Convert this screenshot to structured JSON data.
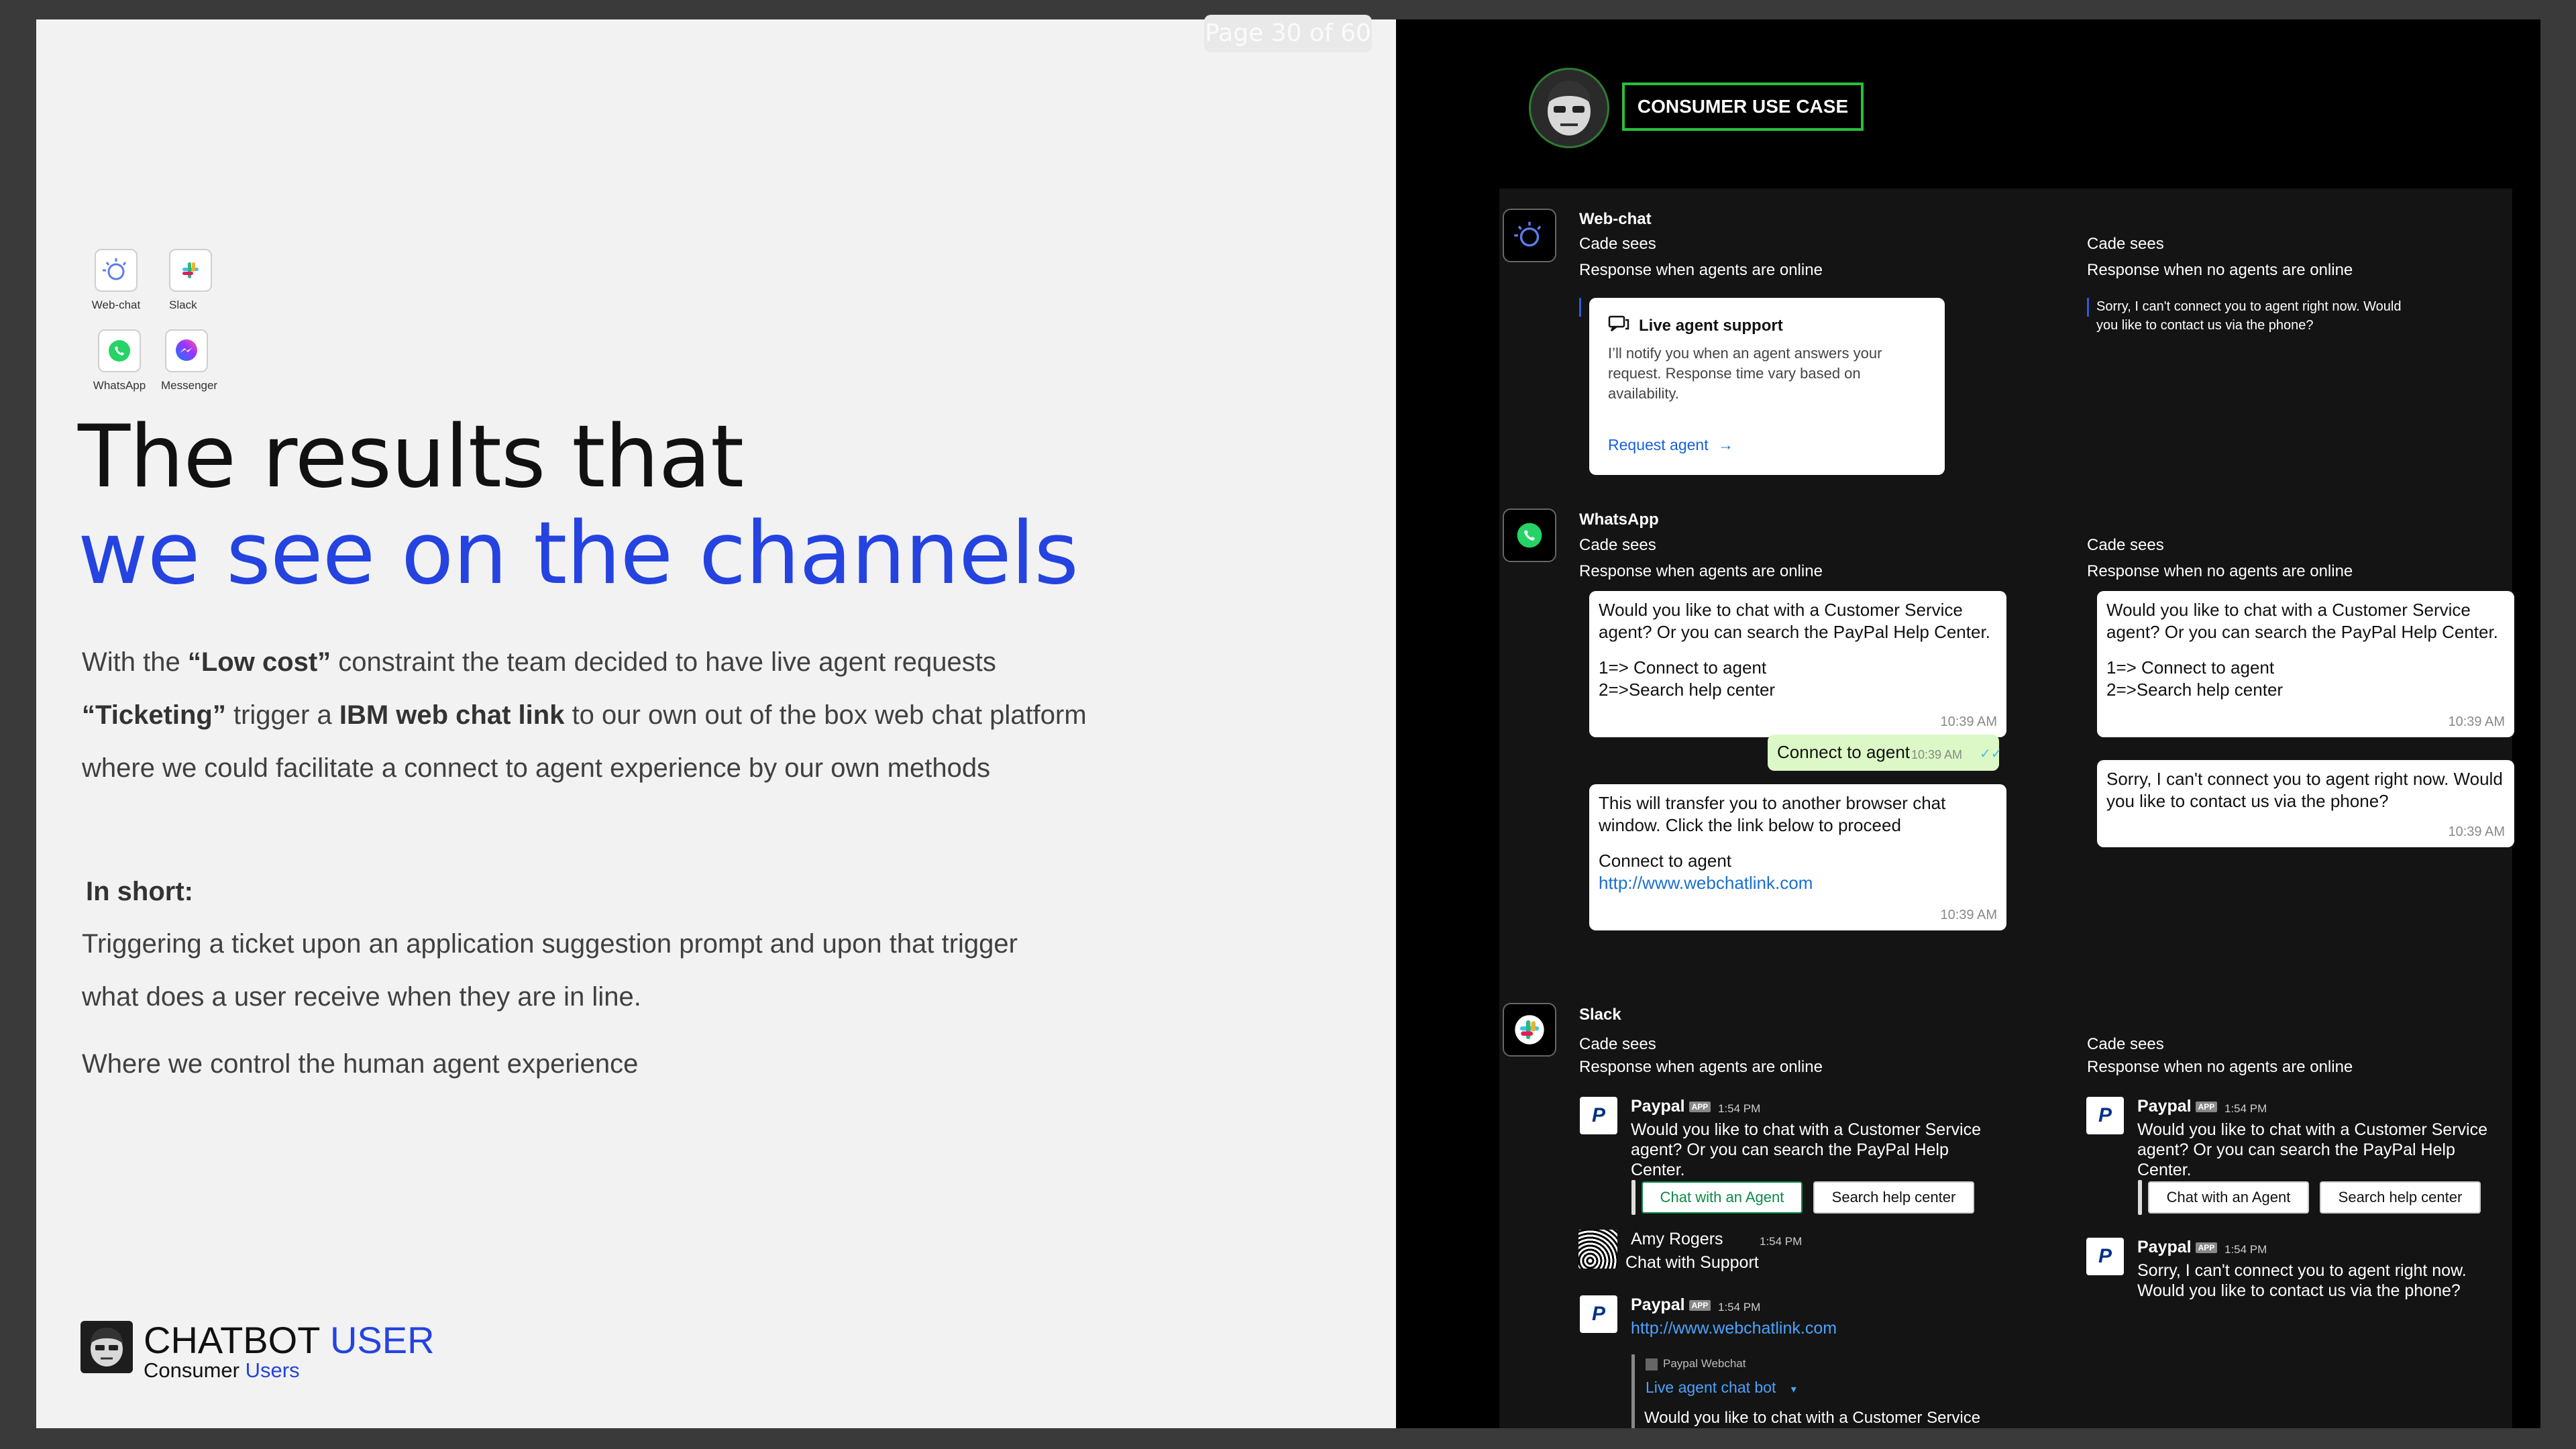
{
  "page_indicator": "Page 30 of 60",
  "channels": [
    {
      "label": "Web-chat",
      "icon": "ibm-watson-icon"
    },
    {
      "label": "Slack",
      "icon": "slack-icon"
    },
    {
      "label": "WhatsApp",
      "icon": "whatsapp-icon"
    },
    {
      "label": "Messenger",
      "icon": "messenger-icon"
    }
  ],
  "title": {
    "line1": "The results that",
    "line2": "we see on the channels"
  },
  "body": {
    "p1_pre": "With the ",
    "p1_bold": "“Low cost”",
    "p1_post": " constraint the team decided to have live agent requests",
    "p2_bold1": "“Ticketing”",
    "p2_mid": " trigger a ",
    "p2_bold2": "IBM web chat link",
    "p2_post": " to our own out of the box web chat platform",
    "p3": "where we could facilitate a connect to agent experience by our own methods",
    "in_short": "In short:",
    "p4": "Triggering a ticket upon an application suggestion prompt and upon that trigger",
    "p5": "what does a user receive when they are in line.",
    "p6": "Where we control the human agent experience"
  },
  "brand": {
    "name_a": "CHATBOT",
    "name_b": " USER",
    "sub_a": "Consumer",
    "sub_b": " Users"
  },
  "right": {
    "badge": "CONSUMER USE CASE",
    "cade_sees": "Cade sees",
    "online": "Response when agents are online",
    "offline": "Response when no agents are online",
    "webchat": {
      "title": "Web-chat",
      "card_title": "Live agent support",
      "card_text": "I’ll notify you when an agent answers your request. Response time vary based on availability.",
      "card_link": "Request agent",
      "offline_msg": "Sorry, I can't connect you to agent right now. Would you like to contact us via the phone?"
    },
    "whatsapp": {
      "title": "WhatsApp",
      "msg1_a": "Would you like to chat with a Customer Service agent? Or you can search the PayPal Help Center.",
      "msg1_b": "1=> Connect to agent",
      "msg1_c": "2=>Search help center",
      "time": "10:39 AM",
      "reply": "Connect to agent",
      "msg2_a": "This will transfer you to another browser chat window. Click the link below to proceed",
      "msg2_b": "Connect to agent",
      "msg2_link": "http://www.webchatlink.com",
      "off_msg": "Sorry, I can't connect you to agent right now. Would you like to contact us via the phone?"
    },
    "slack": {
      "title": "Slack",
      "bot": "Paypal",
      "app": "APP",
      "time": "1:54 PM",
      "msg": "Would you like to chat with a Customer Service agent? Or you can search the PayPal Help Center.",
      "btn1": "Chat with an Agent",
      "btn2": "Search help center",
      "user": "Amy Rogers",
      "user_msg": "Chat with Support",
      "link": "http://www.webchatlink.com",
      "attach_src": "Paypal Webchat",
      "attach_title": "Live agent chat bot",
      "attach_msg": "Would you like to chat with a Customer Service agent?",
      "off_msg": "Sorry, I can't connect you to agent right now. Would you like to contact us via the phone?"
    }
  }
}
